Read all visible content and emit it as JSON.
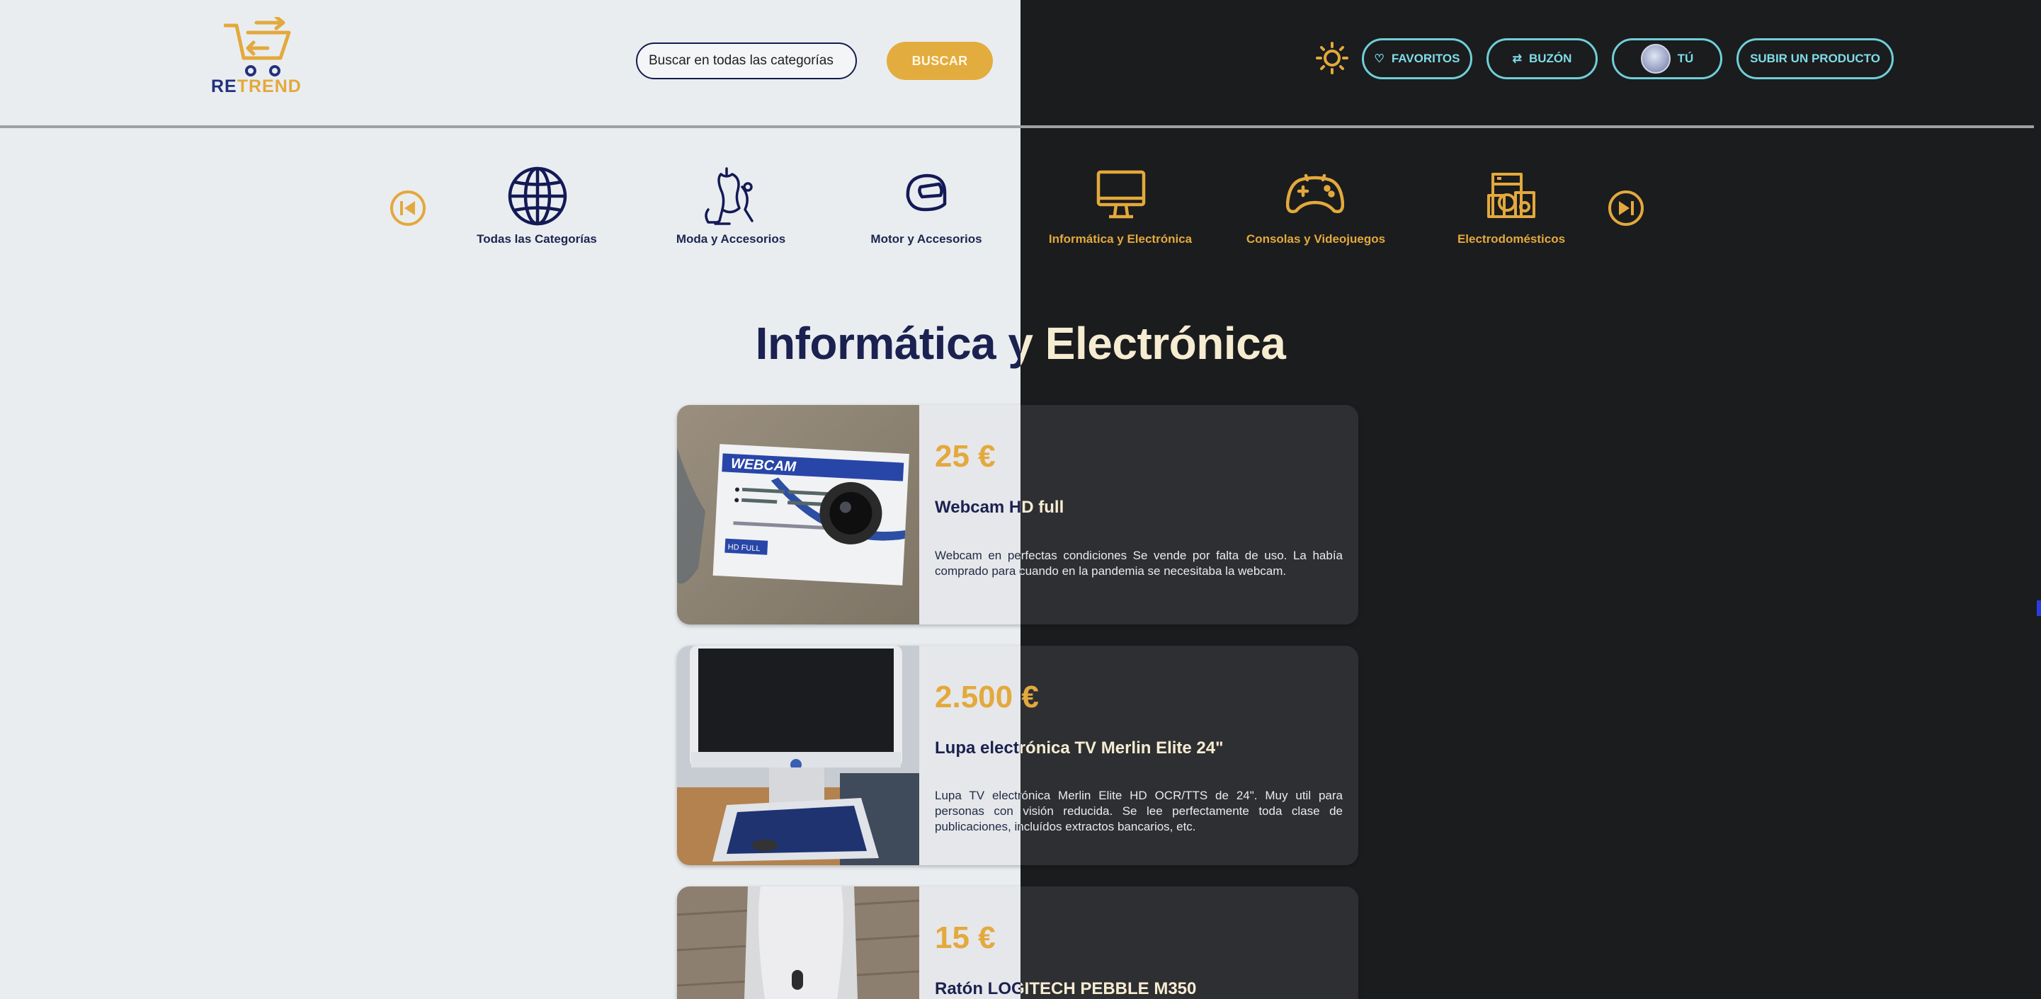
{
  "brand": {
    "re": "RE",
    "trend": "TREND",
    "colors": {
      "navy": "#23307e",
      "gold": "#e3a93c"
    }
  },
  "search": {
    "placeholder": "Buscar en todas las categorías",
    "value": "",
    "button_label": "BUSCAR"
  },
  "header": {
    "theme_toggle_icon": "sun-icon",
    "favorites": {
      "label": "FAVORITOS",
      "icon": "heart-icon"
    },
    "inbox": {
      "label": "BUZÓN",
      "icon": "swap-icon"
    },
    "profile": {
      "label": "TÚ",
      "icon": "avatar"
    },
    "upload": {
      "label": "SUBIR UN PRODUCTO"
    }
  },
  "categories": [
    {
      "label": "Todas las Categorías",
      "icon": "globe-icon"
    },
    {
      "label": "Moda y Accesorios",
      "icon": "mannequin-icon"
    },
    {
      "label": "Motor y Accesorios",
      "icon": "helmet-icon"
    },
    {
      "label": "Informática y Electrónica",
      "icon": "monitor-icon"
    },
    {
      "label": "Consolas y Videojuegos",
      "icon": "gamepad-icon"
    },
    {
      "label": "Electrodomésticos",
      "icon": "appliances-icon"
    }
  ],
  "section_title": "Informática y Electrónica",
  "products": [
    {
      "price": "25 €",
      "title": "Webcam HD full",
      "description": "Webcam en perfectas condiciones Se vende por falta de uso. La había comprado para cuando en la pandemia se necesitaba la webcam.",
      "image": "webcam-photo"
    },
    {
      "price": "2.500 €",
      "title": "Lupa electrónica TV Merlin Elite 24\"",
      "description": "Lupa TV electrónica Merlin Elite HD OCR/TTS de 24\". Muy util para personas con visión reducida. Se lee perfectamente toda clase de publicaciones, incluídos extractos bancarios, etc.",
      "image": "magnifier-photo"
    },
    {
      "price": "15 €",
      "title": "Ratón LOGITECH PEBBLE M350",
      "description": "",
      "image": "mouse-photo"
    }
  ],
  "image_text": {
    "webcam_box": "WEBCAM",
    "webcam_hd": "HD FULL"
  }
}
